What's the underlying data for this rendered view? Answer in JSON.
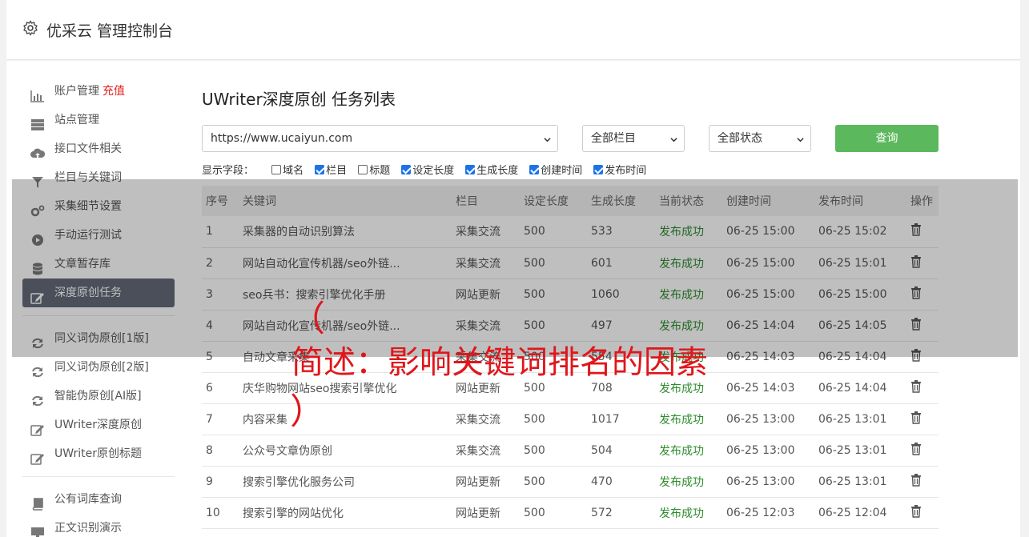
{
  "app": {
    "title": "优采云 管理控制台"
  },
  "sidebar": {
    "items": [
      {
        "label": "账户管理",
        "extra": "充值",
        "icon": "bar-chart-icon"
      },
      {
        "label": "站点管理",
        "icon": "server-icon"
      },
      {
        "label": "接口文件相关",
        "icon": "cloud-upload-icon"
      },
      {
        "label": "栏目与关键词",
        "icon": "filter-icon"
      },
      {
        "label": "采集细节设置",
        "icon": "gears-icon"
      },
      {
        "label": "手动运行测试",
        "icon": "play-icon"
      },
      {
        "label": "文章暂存库",
        "icon": "database-icon"
      },
      {
        "label": "深度原创任务",
        "icon": "edit-icon"
      },
      {
        "label": "同义词伪原创[1版]",
        "icon": "refresh-icon"
      },
      {
        "label": "同义词伪原创[2版]",
        "icon": "refresh-icon"
      },
      {
        "label": "智能伪原创[AI版]",
        "icon": "refresh-icon"
      },
      {
        "label": "UWriter深度原创",
        "icon": "edit-icon"
      },
      {
        "label": "UWriter原创标题",
        "icon": "edit-icon"
      },
      {
        "label": "公有词库查询",
        "icon": "book-icon"
      },
      {
        "label": "正文识别演示",
        "icon": "monitor-icon"
      }
    ]
  },
  "main": {
    "title": "UWriter深度原创 任务列表",
    "site_select": "https://www.ucaiyun.com",
    "column_select": "全部栏目",
    "status_select": "全部状态",
    "query_label": "查询",
    "fields_label": "显示字段：",
    "fields": [
      {
        "label": "域名",
        "checked": false
      },
      {
        "label": "栏目",
        "checked": true
      },
      {
        "label": "标题",
        "checked": false
      },
      {
        "label": "设定长度",
        "checked": true
      },
      {
        "label": "生成长度",
        "checked": true
      },
      {
        "label": "创建时间",
        "checked": true
      },
      {
        "label": "发布时间",
        "checked": true
      }
    ],
    "table": {
      "headers": [
        "序号",
        "关键词",
        "栏目",
        "设定长度",
        "生成长度",
        "当前状态",
        "创建时间",
        "发布时间",
        "操作"
      ],
      "rows": [
        [
          "1",
          "采集器的自动识别算法",
          "采集交流",
          "500",
          "533",
          "发布成功",
          "06-25 15:00",
          "06-25 15:02"
        ],
        [
          "2",
          "网站自动化宣传机器/seo外链...",
          "采集交流",
          "500",
          "601",
          "发布成功",
          "06-25 15:00",
          "06-25 15:01"
        ],
        [
          "3",
          "seo兵书：搜索引擎优化手册",
          "网站更新",
          "500",
          "1060",
          "发布成功",
          "06-25 15:00",
          "06-25 15:00"
        ],
        [
          "4",
          "网站自动化宣传机器/seo外链...",
          "采集交流",
          "500",
          "497",
          "发布成功",
          "06-25 14:04",
          "06-25 14:05"
        ],
        [
          "5",
          "自动文章采集",
          "采集交流",
          "500",
          "554",
          "发布成功",
          "06-25 14:03",
          "06-25 14:04"
        ],
        [
          "6",
          "庆华购物网站seo搜索引擎优化",
          "网站更新",
          "500",
          "708",
          "发布成功",
          "06-25 14:03",
          "06-25 14:04"
        ],
        [
          "7",
          "内容采集",
          "采集交流",
          "500",
          "1017",
          "发布成功",
          "06-25 13:00",
          "06-25 13:01"
        ],
        [
          "8",
          "公众号文章伪原创",
          "采集交流",
          "500",
          "504",
          "发布成功",
          "06-25 13:00",
          "06-25 13:01"
        ],
        [
          "9",
          "搜索引擎优化服务公司",
          "网站更新",
          "500",
          "470",
          "发布成功",
          "06-25 13:00",
          "06-25 13:01"
        ],
        [
          "10",
          "搜索引擎的网站优化",
          "网站更新",
          "500",
          "572",
          "发布成功",
          "06-25 12:03",
          "06-25 12:04"
        ]
      ]
    }
  },
  "watermark": {
    "open": "（",
    "text": "简述：影响关键词排名的因素",
    "close": "）"
  },
  "colors": {
    "active_nav": "#636a78",
    "query_button": "#5cb85c",
    "status_ok": "#2e8b2e",
    "watermark": "#e0161b"
  }
}
